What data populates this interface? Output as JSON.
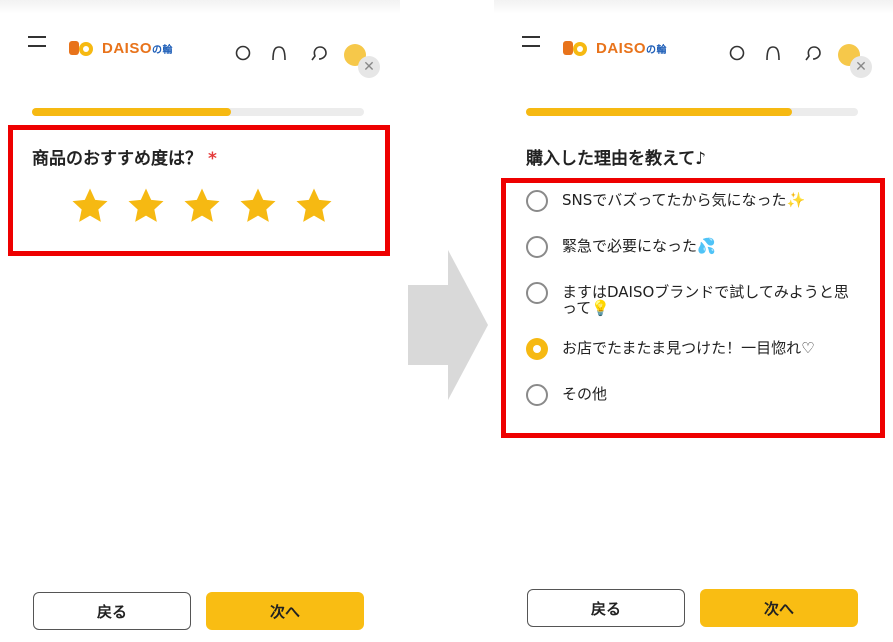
{
  "brand": {
    "name": "DAISO",
    "suffix": "の輪",
    "primary_color": "#f6b912",
    "highlight_color": "#ee0000"
  },
  "left_screen": {
    "progress_fraction": 0.6,
    "question": "商品のおすすめ度は？",
    "required_mark": "*",
    "rating": {
      "value": 5,
      "max": 5
    },
    "back_button": "戻る",
    "next_button": "次へ"
  },
  "right_screen": {
    "progress_fraction": 0.8,
    "question": "購入した理由を教えて♪",
    "options": [
      {
        "label": "SNSでバズってたから気になった✨",
        "selected": false
      },
      {
        "label": "緊急で必要になった💦",
        "selected": false
      },
      {
        "label": "ますはDAISOブランドで試してみようと思って💡",
        "selected": false
      },
      {
        "label": "お店でたまたま見つけた！一目惚れ♡",
        "selected": true
      },
      {
        "label": "その他",
        "selected": false
      }
    ],
    "back_button": "戻る",
    "next_button": "次へ"
  },
  "icons": [
    "hamburger-menu-icon",
    "search-icon",
    "bell-icon",
    "chat-icon",
    "avatar-icon",
    "close-icon",
    "star-icon",
    "arrow-right-icon"
  ]
}
